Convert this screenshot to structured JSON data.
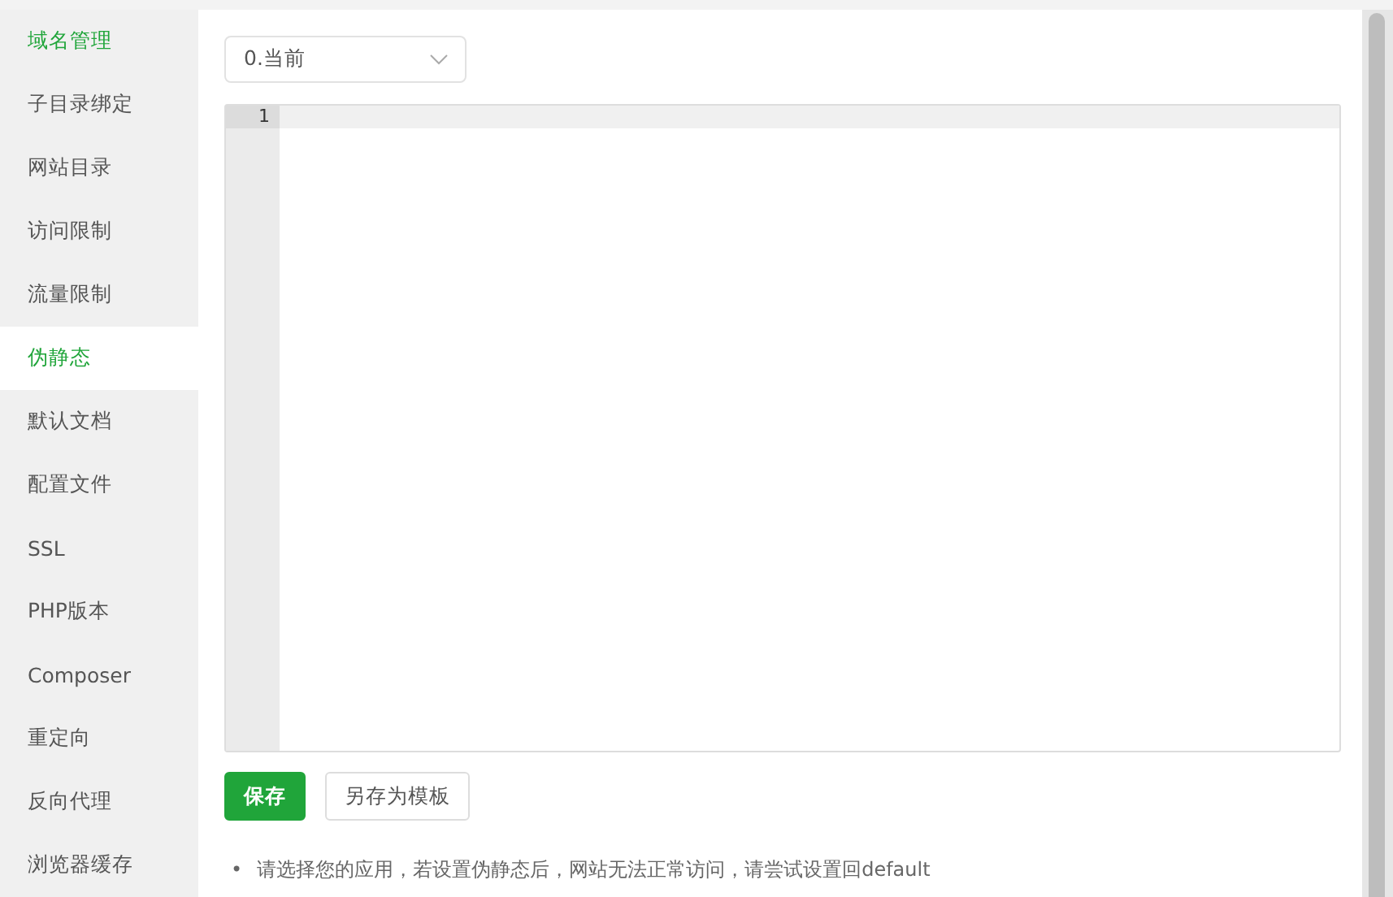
{
  "sidebar": {
    "items": [
      {
        "label": "域名管理",
        "selected": false,
        "hover": true
      },
      {
        "label": "子目录绑定",
        "selected": false,
        "hover": false
      },
      {
        "label": "网站目录",
        "selected": false,
        "hover": false
      },
      {
        "label": "访问限制",
        "selected": false,
        "hover": false
      },
      {
        "label": "流量限制",
        "selected": false,
        "hover": false
      },
      {
        "label": "伪静态",
        "selected": true,
        "hover": false
      },
      {
        "label": "默认文档",
        "selected": false,
        "hover": false
      },
      {
        "label": "配置文件",
        "selected": false,
        "hover": false
      },
      {
        "label": "SSL",
        "selected": false,
        "hover": false
      },
      {
        "label": "PHP版本",
        "selected": false,
        "hover": false
      },
      {
        "label": "Composer",
        "selected": false,
        "hover": false
      },
      {
        "label": "重定向",
        "selected": false,
        "hover": false
      },
      {
        "label": "反向代理",
        "selected": false,
        "hover": false
      },
      {
        "label": "浏览器缓存",
        "selected": false,
        "hover": false
      }
    ]
  },
  "template_select": {
    "value": "0.当前"
  },
  "editor": {
    "line_numbers": [
      "1"
    ]
  },
  "buttons": [
    {
      "label": "保存",
      "kind": "primary"
    },
    {
      "label": "另存为模板",
      "kind": "default"
    }
  ],
  "tips": [
    {
      "bullet": "•",
      "text": "请选择您的应用，若设置伪静态后，网站无法正常访问，请尝试设置回default"
    }
  ]
}
